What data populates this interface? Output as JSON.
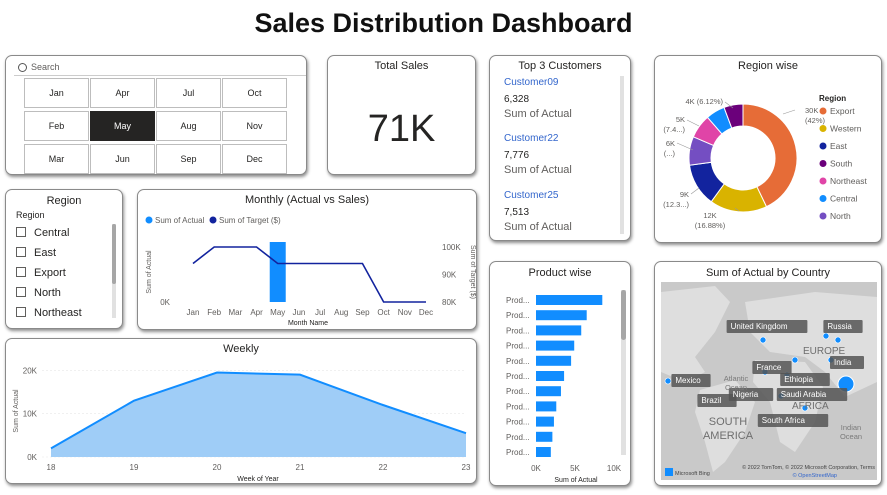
{
  "page": {
    "title": "Sales Distribution Dashboard"
  },
  "slicer_month": {
    "search_placeholder": "Search",
    "months": [
      "Jan",
      "Apr",
      "Jul",
      "Oct",
      "Feb",
      "May",
      "Aug",
      "Nov",
      "Mar",
      "Jun",
      "Sep",
      "Dec"
    ],
    "selected": "May"
  },
  "total_sales": {
    "title": "Total Sales",
    "value": "71K"
  },
  "top_customers": {
    "title": "Top 3 Customers",
    "items": [
      {
        "name": "Customer09",
        "value": "6,328",
        "label": "Sum of Actual"
      },
      {
        "name": "Customer22",
        "value": "7,776",
        "label": "Sum of Actual"
      },
      {
        "name": "Customer25",
        "value": "7,513",
        "label": "Sum of Actual"
      }
    ]
  },
  "region_slicer": {
    "title": "Region",
    "header": "Region",
    "items": [
      "Central",
      "East",
      "Export",
      "North",
      "Northeast"
    ]
  },
  "region_donut": {
    "title": "Region wise",
    "legend_title": "Region",
    "labels": [
      "30K\n(42%)",
      "12K\n(16.88%)",
      "9K\n(12.3...)",
      "6K\n(...)",
      "5K\n(7.4...)",
      "4K (6.12%)"
    ],
    "colors": {
      "Export": "#e66c37",
      "Western": "#d9b300",
      "East": "#12239e",
      "South": "#6b007b",
      "Northeast": "#e044a7",
      "Central": "#118dff",
      "North": "#744ec2"
    }
  },
  "product_bars_title": "Product wise",
  "map": {
    "title": "Sum of Actual by Country",
    "labels": [
      "United Kingdom",
      "Russia",
      "EUROPE",
      "India",
      "France",
      "Ethiopia",
      "Mexico",
      "Atlantic\nOcean",
      "Brazil",
      "Nigeria",
      "Saudi Arabia",
      "AFRICA",
      "SOUTH\nAMERICA",
      "South Africa",
      "Indian\nOcean"
    ],
    "copyright": "© 2022 TomTom, © 2022 Microsoft Corporation, Terms",
    "osm": "© OpenStreetMap",
    "brand": "Microsoft Bing"
  },
  "chart_data": [
    {
      "type": "line",
      "title": "Monthly (Actual vs Sales)",
      "legend": [
        "Sum of Actual",
        "Sum of Target ($)"
      ],
      "categories": [
        "Jan",
        "Feb",
        "Mar",
        "Apr",
        "May",
        "Jun",
        "Jul",
        "Aug",
        "Sep",
        "Oct",
        "Nov",
        "Dec"
      ],
      "series": [
        {
          "name": "Sum of Actual",
          "type": "bar",
          "color": "#118dff",
          "values": [
            null,
            null,
            null,
            null,
            60,
            null,
            null,
            null,
            null,
            null,
            null,
            null
          ]
        },
        {
          "name": "Sum of Target ($)",
          "type": "line",
          "color": "#12239e",
          "values": [
            94,
            100,
            100,
            100,
            94,
            94,
            94,
            94,
            94,
            80,
            80,
            80
          ]
        }
      ],
      "xlabel": "Month Name",
      "ylabel": "Sum of Actual",
      "y2label": "Sum of Target ($)",
      "y_ticks": [
        "0K"
      ],
      "y2_ticks": [
        "100K",
        "90K",
        "80K"
      ],
      "y2lim": [
        80,
        104
      ]
    },
    {
      "type": "area",
      "title": "Weekly",
      "x": [
        18,
        19,
        20,
        21,
        22,
        23
      ],
      "values": [
        2,
        13,
        19.5,
        19,
        12,
        5.5
      ],
      "xlabel": "Week of Year",
      "ylabel": "Sum of Actual",
      "y_ticks": [
        "20K",
        "10K",
        "0K"
      ],
      "ylim": [
        0,
        21
      ],
      "color": "#118dff"
    },
    {
      "type": "bar",
      "title": "Product wise",
      "categories": [
        "Prod...",
        "Prod...",
        "Prod...",
        "Prod...",
        "Prod...",
        "Prod...",
        "Prod...",
        "Prod...",
        "Prod...",
        "Prod...",
        "Prod..."
      ],
      "values": [
        8.5,
        6.5,
        5.8,
        4.9,
        4.5,
        3.6,
        3.2,
        2.6,
        2.3,
        2.1,
        1.9
      ],
      "xlabel": "Sum of Actual",
      "x_ticks": [
        "0K",
        "5K",
        "10K"
      ],
      "xlim": [
        0,
        10
      ],
      "color": "#118dff"
    },
    {
      "type": "pie",
      "title": "Region wise",
      "categories": [
        "Export",
        "Western",
        "East",
        "South",
        "Northeast",
        "Central",
        "North"
      ],
      "values": [
        30,
        12,
        9,
        6,
        5,
        4,
        4
      ],
      "colors": [
        "#e66c37",
        "#d9b300",
        "#12239e",
        "#744ec2",
        "#e044a7",
        "#118dff",
        "#6b007b"
      ]
    }
  ]
}
